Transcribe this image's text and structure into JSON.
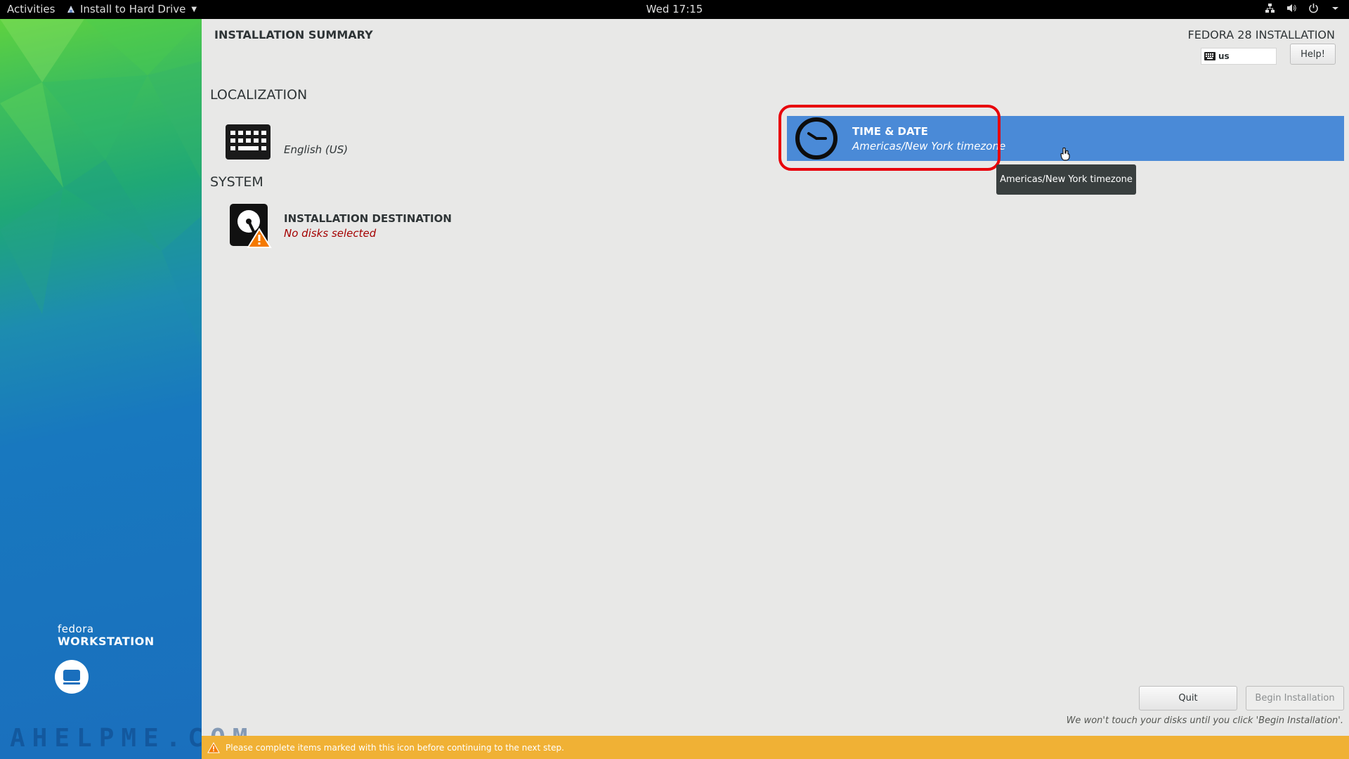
{
  "topbar": {
    "activities": "Activities",
    "app_menu": "Install to Hard Drive",
    "clock": "Wed 17:15",
    "tray_icons": [
      "network-icon",
      "volume-icon",
      "power-icon",
      "chevron-down-icon"
    ]
  },
  "sidebar": {
    "brand_small": "fedora",
    "brand_large": "WORKSTATION",
    "watermark": "AHELPME.COM"
  },
  "header": {
    "title": "INSTALLATION SUMMARY",
    "product": "FEDORA 28 INSTALLATION",
    "keyboard_layout": "us",
    "help_label": "Help!"
  },
  "sections": {
    "localization": {
      "title": "LOCALIZATION",
      "keyboard": {
        "status": "English (US)"
      },
      "time_date": {
        "label": "TIME & DATE",
        "status": "Americas/New York timezone",
        "tooltip": "Americas/New York timezone"
      }
    },
    "system": {
      "title": "SYSTEM",
      "destination": {
        "label": "INSTALLATION DESTINATION",
        "status": "No disks selected"
      }
    }
  },
  "footer": {
    "quit_label": "Quit",
    "begin_label": "Begin Installation",
    "note": "We won't touch your disks until you click 'Begin Installation'.",
    "warning": "Please complete items marked with this icon before continuing to the next step."
  },
  "colors": {
    "selected_spoke": "#4a8ad7",
    "highlight_ring": "#e8000a",
    "warning_bar": "#f0b135",
    "error_text": "#a40000"
  }
}
